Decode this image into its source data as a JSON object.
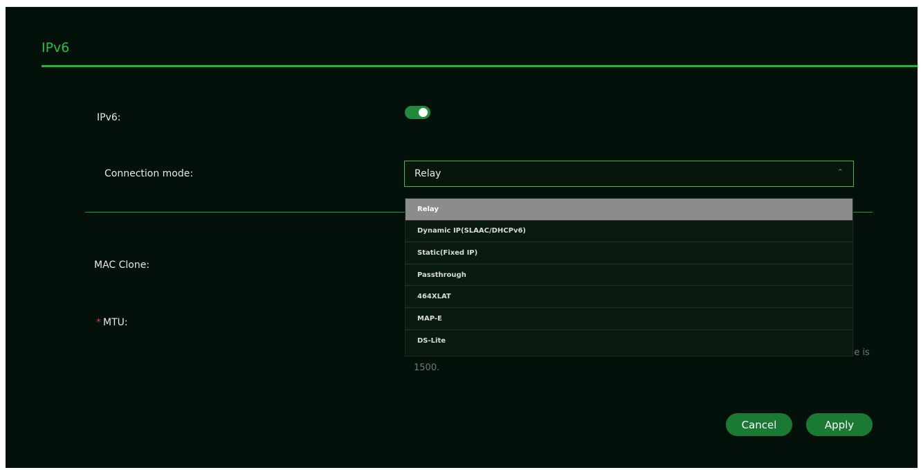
{
  "section": {
    "title": "IPv6"
  },
  "fields": {
    "ipv6_label": "IPv6:",
    "ipv6_enabled": true,
    "connection_mode_label": "Connection mode:",
    "connection_mode_value": "Relay",
    "mac_clone_label": "MAC Clone:",
    "mtu_required_mark": "*",
    "mtu_label": "MTU:",
    "mtu_hint_tail": "ue is",
    "mtu_hint_value": "1500."
  },
  "dropdown": {
    "options": [
      "Relay",
      "Dynamic IP(SLAAC/DHCPv6)",
      "Static(Fixed IP)",
      "Passthrough",
      "464XLAT",
      "MAP-E",
      "DS-Lite"
    ],
    "selected_index": 0
  },
  "buttons": {
    "cancel": "Cancel",
    "apply": "Apply"
  },
  "colors": {
    "accent": "#22c33a",
    "panel_bg": "#04100a",
    "button_bg": "#1a7a33",
    "selected_option_bg": "#8c8c8c"
  },
  "icons": {
    "select_chevron": "chevron-up-icon"
  }
}
